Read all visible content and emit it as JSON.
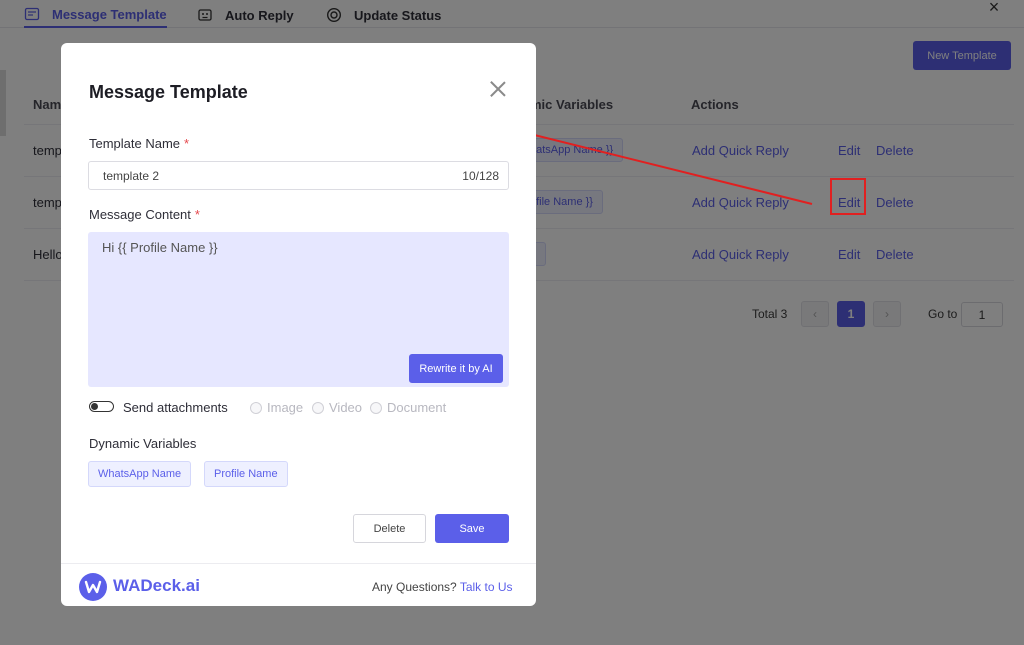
{
  "tabs": [
    {
      "label": "Message Template",
      "icon": "template-icon",
      "active": true
    },
    {
      "label": "Auto Reply",
      "icon": "robot-icon",
      "active": false
    },
    {
      "label": "Update Status",
      "icon": "status-icon",
      "active": false
    }
  ],
  "page": {
    "new_template_label": "New Template",
    "headers": {
      "name": "Nam",
      "dynamic_variables": "mic Variables",
      "actions": "Actions"
    },
    "rows": [
      {
        "name": "temp",
        "variable": "hatsApp Name }}",
        "quick_reply": "Add Quick Reply",
        "edit": "Edit",
        "delete": "Delete"
      },
      {
        "name": "temp",
        "variable": "ofile Name }}",
        "quick_reply": "Add Quick Reply",
        "edit": "Edit",
        "delete": "Delete"
      },
      {
        "name": "Hello",
        "variable": "e",
        "quick_reply": "Add Quick Reply",
        "edit": "Edit",
        "delete": "Delete"
      }
    ],
    "pagination": {
      "total": "Total 3",
      "current": "1",
      "prev": "‹",
      "next": "›",
      "goto_label": "Go to",
      "goto_value": "1"
    }
  },
  "modal": {
    "title": "Message Template",
    "template_name_label": "Template Name",
    "required_mark": "*",
    "template_name_value": "template 2",
    "template_name_count": "10/128",
    "message_content_label": "Message Content",
    "message_content_value": "Hi {{ Profile Name }}",
    "rewrite_label": "Rewrite it by AI",
    "attach_label": "Send attachments",
    "attach_options": [
      "Image",
      "Video",
      "Document"
    ],
    "dynamic_label": "Dynamic Variables",
    "dynamic_vars": [
      "WhatsApp Name",
      "Profile Name"
    ],
    "delete_label": "Delete",
    "save_label": "Save",
    "brand": "WADeck.ai",
    "question": "Any Questions?",
    "talk_link": "Talk to Us"
  },
  "colors": {
    "accent": "#5b5fe9",
    "annotation": "#e12020",
    "content_bg": "#e6e7ff"
  }
}
